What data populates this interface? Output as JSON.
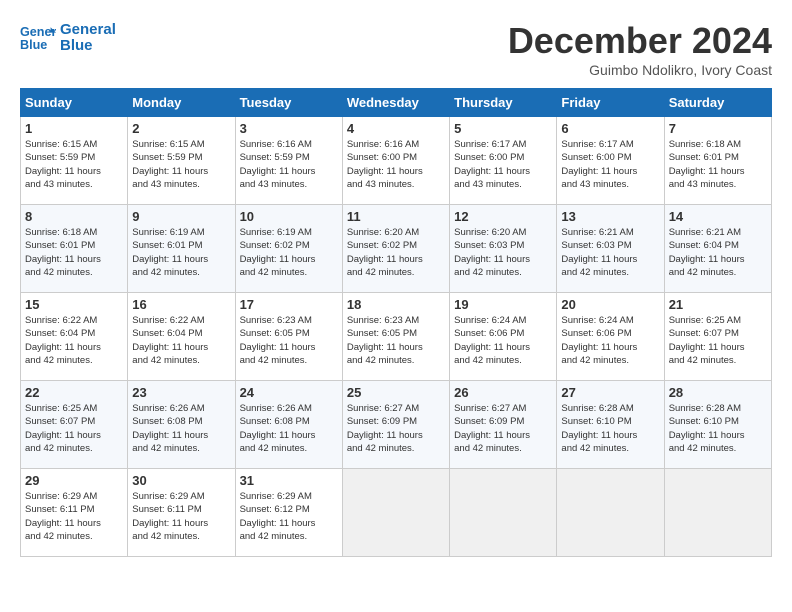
{
  "logo": {
    "line1": "General",
    "line2": "Blue"
  },
  "title": "December 2024",
  "location": "Guimbo Ndolikro, Ivory Coast",
  "days_of_week": [
    "Sunday",
    "Monday",
    "Tuesday",
    "Wednesday",
    "Thursday",
    "Friday",
    "Saturday"
  ],
  "weeks": [
    [
      {
        "day": 1,
        "sunrise": "6:15 AM",
        "sunset": "5:59 PM",
        "daylight": "11 hours and 43 minutes."
      },
      {
        "day": 2,
        "sunrise": "6:15 AM",
        "sunset": "5:59 PM",
        "daylight": "11 hours and 43 minutes."
      },
      {
        "day": 3,
        "sunrise": "6:16 AM",
        "sunset": "5:59 PM",
        "daylight": "11 hours and 43 minutes."
      },
      {
        "day": 4,
        "sunrise": "6:16 AM",
        "sunset": "6:00 PM",
        "daylight": "11 hours and 43 minutes."
      },
      {
        "day": 5,
        "sunrise": "6:17 AM",
        "sunset": "6:00 PM",
        "daylight": "11 hours and 43 minutes."
      },
      {
        "day": 6,
        "sunrise": "6:17 AM",
        "sunset": "6:00 PM",
        "daylight": "11 hours and 43 minutes."
      },
      {
        "day": 7,
        "sunrise": "6:18 AM",
        "sunset": "6:01 PM",
        "daylight": "11 hours and 43 minutes."
      }
    ],
    [
      {
        "day": 8,
        "sunrise": "6:18 AM",
        "sunset": "6:01 PM",
        "daylight": "11 hours and 42 minutes."
      },
      {
        "day": 9,
        "sunrise": "6:19 AM",
        "sunset": "6:01 PM",
        "daylight": "11 hours and 42 minutes."
      },
      {
        "day": 10,
        "sunrise": "6:19 AM",
        "sunset": "6:02 PM",
        "daylight": "11 hours and 42 minutes."
      },
      {
        "day": 11,
        "sunrise": "6:20 AM",
        "sunset": "6:02 PM",
        "daylight": "11 hours and 42 minutes."
      },
      {
        "day": 12,
        "sunrise": "6:20 AM",
        "sunset": "6:03 PM",
        "daylight": "11 hours and 42 minutes."
      },
      {
        "day": 13,
        "sunrise": "6:21 AM",
        "sunset": "6:03 PM",
        "daylight": "11 hours and 42 minutes."
      },
      {
        "day": 14,
        "sunrise": "6:21 AM",
        "sunset": "6:04 PM",
        "daylight": "11 hours and 42 minutes."
      }
    ],
    [
      {
        "day": 15,
        "sunrise": "6:22 AM",
        "sunset": "6:04 PM",
        "daylight": "11 hours and 42 minutes."
      },
      {
        "day": 16,
        "sunrise": "6:22 AM",
        "sunset": "6:04 PM",
        "daylight": "11 hours and 42 minutes."
      },
      {
        "day": 17,
        "sunrise": "6:23 AM",
        "sunset": "6:05 PM",
        "daylight": "11 hours and 42 minutes."
      },
      {
        "day": 18,
        "sunrise": "6:23 AM",
        "sunset": "6:05 PM",
        "daylight": "11 hours and 42 minutes."
      },
      {
        "day": 19,
        "sunrise": "6:24 AM",
        "sunset": "6:06 PM",
        "daylight": "11 hours and 42 minutes."
      },
      {
        "day": 20,
        "sunrise": "6:24 AM",
        "sunset": "6:06 PM",
        "daylight": "11 hours and 42 minutes."
      },
      {
        "day": 21,
        "sunrise": "6:25 AM",
        "sunset": "6:07 PM",
        "daylight": "11 hours and 42 minutes."
      }
    ],
    [
      {
        "day": 22,
        "sunrise": "6:25 AM",
        "sunset": "6:07 PM",
        "daylight": "11 hours and 42 minutes."
      },
      {
        "day": 23,
        "sunrise": "6:26 AM",
        "sunset": "6:08 PM",
        "daylight": "11 hours and 42 minutes."
      },
      {
        "day": 24,
        "sunrise": "6:26 AM",
        "sunset": "6:08 PM",
        "daylight": "11 hours and 42 minutes."
      },
      {
        "day": 25,
        "sunrise": "6:27 AM",
        "sunset": "6:09 PM",
        "daylight": "11 hours and 42 minutes."
      },
      {
        "day": 26,
        "sunrise": "6:27 AM",
        "sunset": "6:09 PM",
        "daylight": "11 hours and 42 minutes."
      },
      {
        "day": 27,
        "sunrise": "6:28 AM",
        "sunset": "6:10 PM",
        "daylight": "11 hours and 42 minutes."
      },
      {
        "day": 28,
        "sunrise": "6:28 AM",
        "sunset": "6:10 PM",
        "daylight": "11 hours and 42 minutes."
      }
    ],
    [
      {
        "day": 29,
        "sunrise": "6:29 AM",
        "sunset": "6:11 PM",
        "daylight": "11 hours and 42 minutes."
      },
      {
        "day": 30,
        "sunrise": "6:29 AM",
        "sunset": "6:11 PM",
        "daylight": "11 hours and 42 minutes."
      },
      {
        "day": 31,
        "sunrise": "6:29 AM",
        "sunset": "6:12 PM",
        "daylight": "11 hours and 42 minutes."
      },
      null,
      null,
      null,
      null
    ]
  ]
}
